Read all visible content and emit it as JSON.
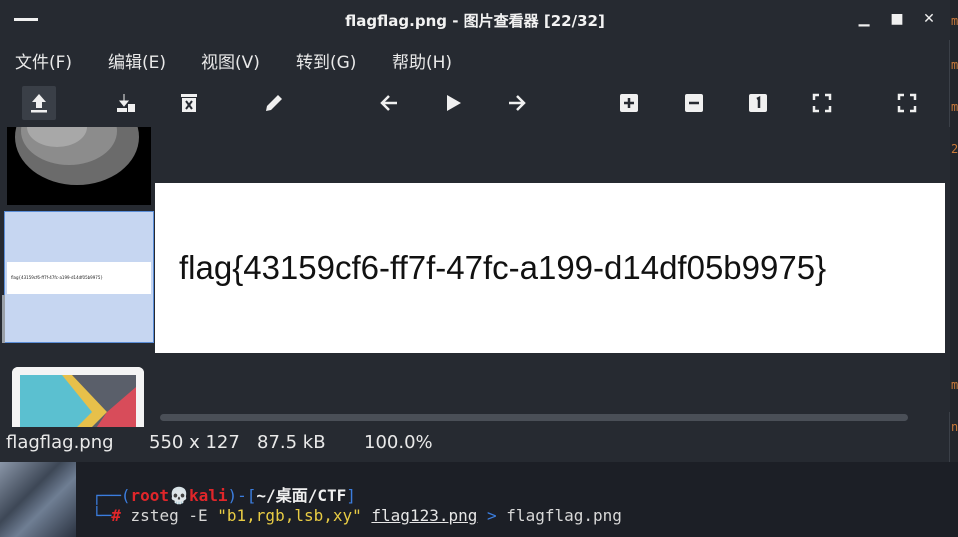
{
  "window": {
    "title": "flagflag.png - 图片查看器 [22/32]"
  },
  "menu": [
    "文件(F)",
    "编辑(E)",
    "视图(V)",
    "转到(G)",
    "帮助(H)"
  ],
  "toolbar": {
    "icons": [
      "upload-icon",
      "save-icon",
      "delete-icon",
      "edit-icon",
      "back-arrow-icon",
      "play-icon",
      "forward-arrow-icon",
      "zoom-in-icon",
      "zoom-out-icon",
      "actual-size-icon",
      "fit-icon",
      "fullscreen-icon"
    ]
  },
  "image": {
    "text": "flag{43159cf6-ff7f-47fc-a199-d14df05b9975}"
  },
  "thumbnail_selected_text": "flag{43159cf6-ff7f-47fc-a199-d14df05b9975}",
  "status": {
    "filename": "flagflag.png",
    "dimensions": "550 x 127",
    "size": "87.5 kB",
    "zoom": "100.0%"
  },
  "terminal": {
    "bracket_open": "┌──(",
    "user": "root",
    "skull": "💀",
    "host": "kali",
    "bracket_mid": ")-[",
    "path": "~/桌面/CTF",
    "bracket_close": "]",
    "prompt_prefix": "└─",
    "prompt": "#",
    "command": "zsteg",
    "flag_opt": "-E",
    "arg": "\"b1,rgb,lsb,xy\"",
    "input_file": "flag123.png",
    "redirect": ">",
    "output_file": "flagflag.png"
  },
  "colors": {
    "window_bg": "#262a31",
    "terminal_bg": "#1c1f26",
    "selection": "#c6d6f1",
    "prompt_red": "#e0262a",
    "prompt_blue": "#3b7dde",
    "string_yellow": "#e8cc44"
  }
}
